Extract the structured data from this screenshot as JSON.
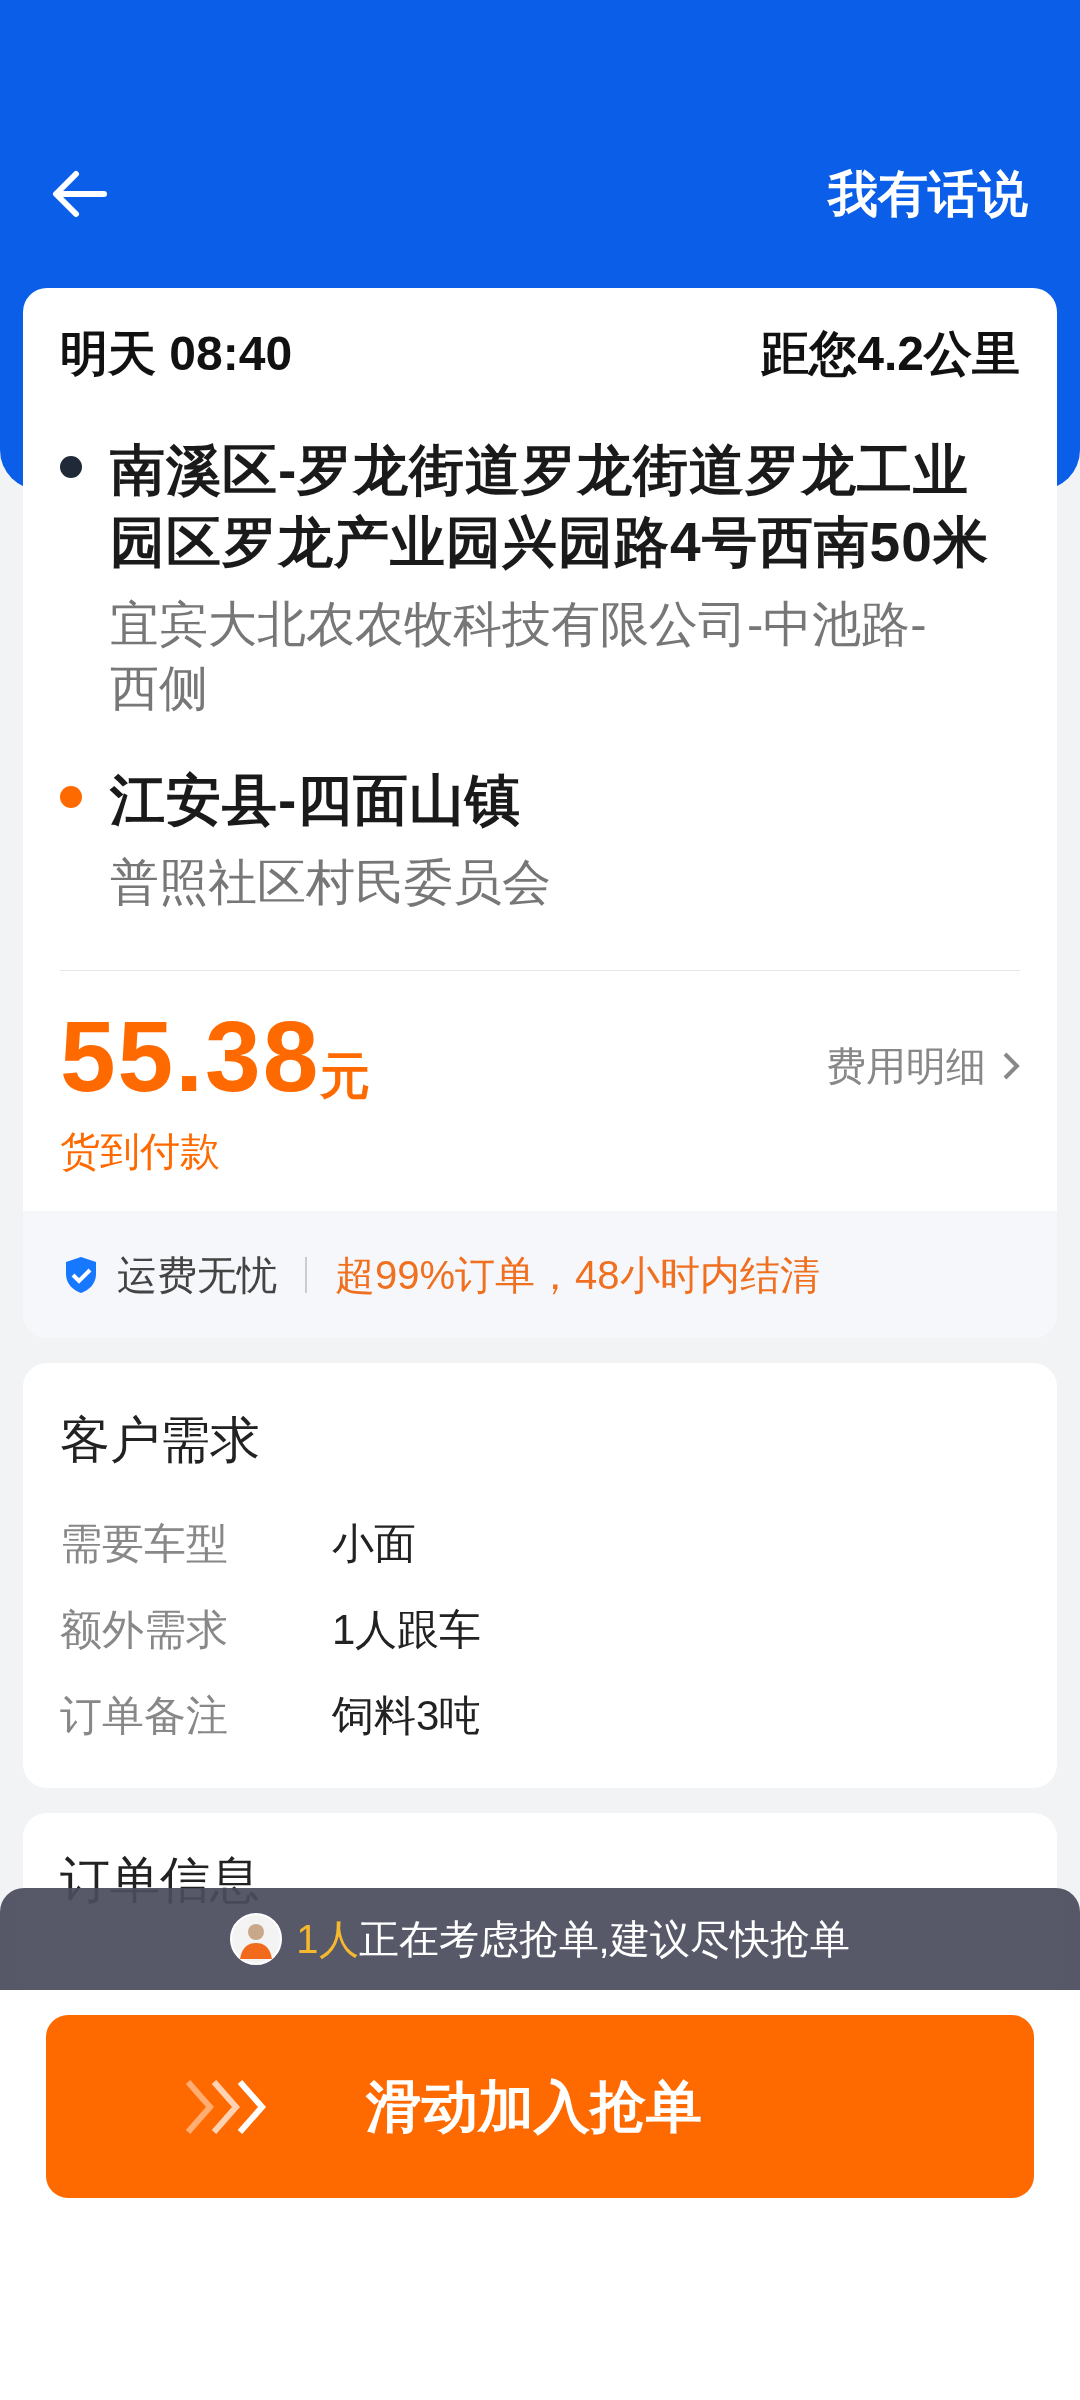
{
  "header": {
    "action": "我有话说"
  },
  "order": {
    "time": "明天 08:40",
    "distance": "距您4.2公里",
    "stops": [
      {
        "color": "#1f2937",
        "address": "南溪区-罗龙街道罗龙街道罗龙工业园区罗龙产业园兴园路4号西南50米",
        "detail": "宜宾大北农农牧科技有限公司-中池路-西侧"
      },
      {
        "color": "#ff6a00",
        "address": "江安县-四面山镇",
        "detail": "普照社区村民委员会"
      }
    ],
    "price": "55.38",
    "unit": "元",
    "payment": "货到付款",
    "fee_link": "费用明细",
    "guarantee": {
      "label": "运费无忧",
      "note": "超99%订单，48小时内结清"
    }
  },
  "requirements": {
    "title": "客户需求",
    "rows": [
      {
        "label": "需要车型",
        "value": "小面"
      },
      {
        "label": "额外需求",
        "value": "1人跟车"
      },
      {
        "label": "订单备注",
        "value": "饲料3吨"
      }
    ]
  },
  "order_info": {
    "title": "订单信息"
  },
  "notice": {
    "count": "1人",
    "text": "正在考虑抢单,建议尽快抢单"
  },
  "slider": {
    "label": "滑动加入抢单"
  }
}
